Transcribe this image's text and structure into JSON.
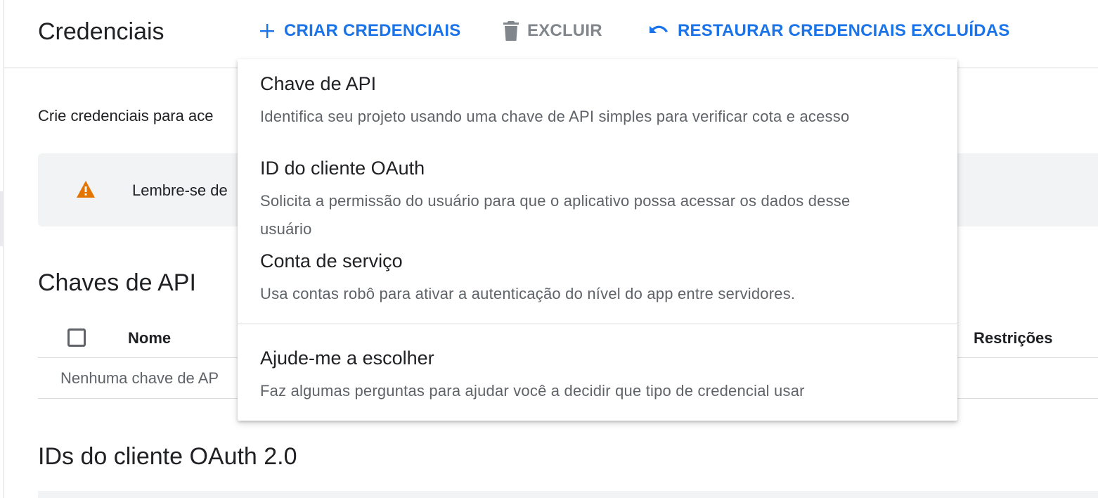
{
  "header": {
    "title": "Credenciais",
    "actions": {
      "create_label": "CRIAR CREDENCIAIS",
      "delete_label": "EXCLUIR",
      "restore_label": "RESTAURAR CREDENCIAIS EXCLUÍDAS"
    }
  },
  "intro_text": "Crie credenciais para ace",
  "banner": {
    "text": "Lembre-se de",
    "icon": "warning-icon"
  },
  "api_keys": {
    "title": "Chaves de API",
    "columns": [
      "Nome",
      "Restrições"
    ],
    "empty_text": "Nenhuma chave de AP"
  },
  "oauth_clients": {
    "title": "IDs do cliente OAuth 2.0"
  },
  "menu": {
    "items": [
      {
        "title": "Chave de API",
        "description": "Identifica seu projeto usando uma chave de API simples para verificar cota e acesso"
      },
      {
        "title": "ID do cliente OAuth",
        "description": "Solicita a permissão do usuário para que o aplicativo possa acessar os dados desse usuário"
      },
      {
        "title": "Conta de serviço",
        "description": "Usa contas robô para ativar a autenticação do nível do app entre servidores."
      },
      {
        "title": "Ajude-me a escolher",
        "description": "Faz algumas perguntas para ajudar você a decidir que tipo de credencial usar"
      }
    ]
  },
  "colors": {
    "accent": "#1a73e8",
    "disabled": "#80868b",
    "warning": "#e37400",
    "banner_bg": "#f1f3f4"
  },
  "icons": [
    "plus-icon",
    "trash-icon",
    "undo-icon",
    "warning-icon"
  ]
}
